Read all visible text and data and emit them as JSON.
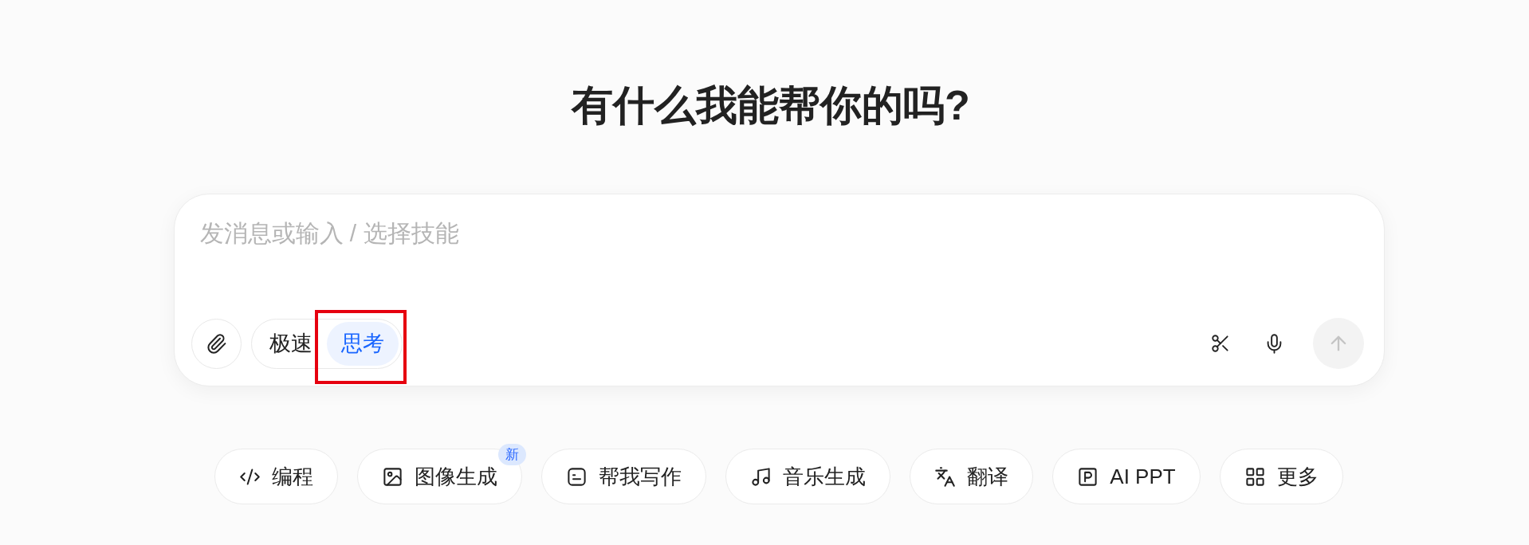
{
  "heading": "有什么我能帮你的吗?",
  "composer": {
    "placeholder": "发消息或输入 / 选择技能",
    "modes": [
      {
        "label": "极速",
        "selected": false,
        "highlighted": false
      },
      {
        "label": "思考",
        "selected": true,
        "highlighted": true
      }
    ],
    "send": {
      "disabled": true
    }
  },
  "skills": [
    {
      "kind": "code",
      "label": "编程"
    },
    {
      "kind": "image",
      "label": "图像生成",
      "badge": "新"
    },
    {
      "kind": "writing",
      "label": "帮我写作"
    },
    {
      "kind": "music",
      "label": "音乐生成"
    },
    {
      "kind": "translate",
      "label": "翻译"
    },
    {
      "kind": "ppt",
      "label": "AI PPT"
    },
    {
      "kind": "more",
      "label": "更多"
    }
  ]
}
